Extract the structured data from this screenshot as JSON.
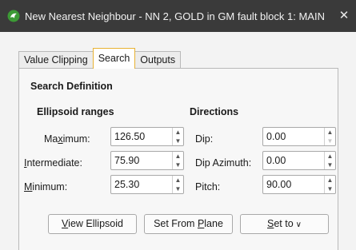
{
  "window": {
    "title": "New Nearest Neighbour - NN 2, GOLD in GM fault block 1: MAIN",
    "close_glyph": "✕"
  },
  "tabs": [
    {
      "label": "Value Clipping",
      "active": false
    },
    {
      "label": "Search",
      "active": true
    },
    {
      "label": "Outputs",
      "active": false
    }
  ],
  "panel": {
    "section_title": "Search Definition",
    "ellipsoid": {
      "title": "Ellipsoid ranges",
      "maximum": {
        "pre": "Ma",
        "key": "x",
        "post": "imum:",
        "value": "126.50"
      },
      "intermediate": {
        "pre": "",
        "key": "I",
        "post": "ntermediate:",
        "value": "75.90"
      },
      "minimum": {
        "pre": "",
        "key": "M",
        "post": "inimum:",
        "value": "25.30"
      }
    },
    "directions": {
      "title": "Directions",
      "dip": {
        "label": "Dip:",
        "value": "0.00"
      },
      "dip_azimuth": {
        "label": "Dip Azimuth:",
        "value": "0.00"
      },
      "pitch": {
        "label": "Pitch:",
        "value": "90.00"
      }
    }
  },
  "buttons": {
    "view_ellipsoid": {
      "key": "V",
      "rest": "iew Ellipsoid"
    },
    "set_from_plane": {
      "pre": "Set From ",
      "key": "P",
      "rest": "lane"
    },
    "set_to": {
      "key": "S",
      "rest": "et to",
      "chevron": "∨"
    }
  },
  "colors": {
    "titlebar": "#3a3a3a",
    "active_tab_border": "#e8b233",
    "icon_green": "#3c9a35"
  },
  "icons": {
    "app": "leapfrog-logo-icon",
    "close": "close-icon",
    "spin_up": "chevron-up-icon",
    "spin_down": "chevron-down-icon",
    "dropdown": "chevron-down-icon"
  }
}
